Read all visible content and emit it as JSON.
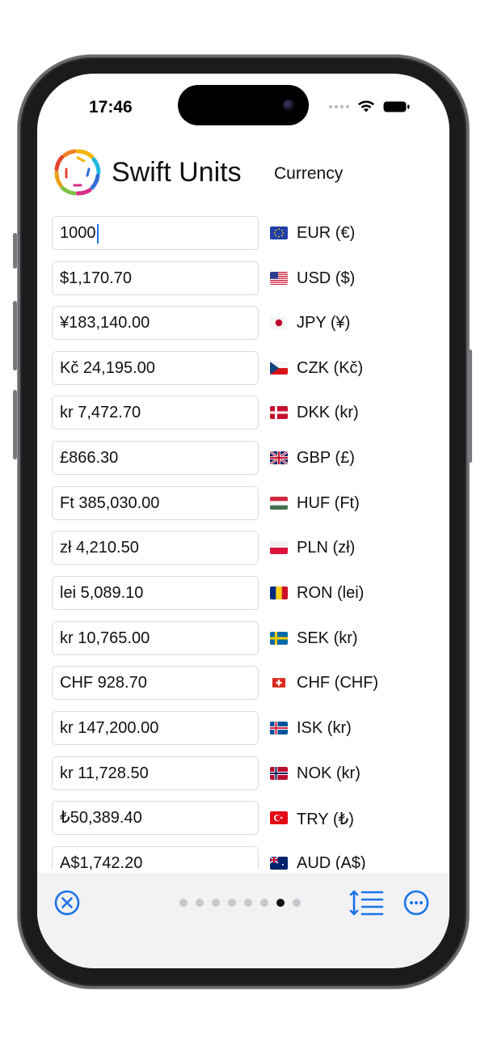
{
  "status": {
    "time": "17:46"
  },
  "header": {
    "app_title": "Swift Units",
    "section": "Currency"
  },
  "currencies": [
    {
      "value": "1000",
      "unit": "EUR (€)",
      "flag": "eu-flag",
      "active": true
    },
    {
      "value": "$1,170.70",
      "unit": "USD ($)",
      "flag": "us-flag"
    },
    {
      "value": "¥183,140.00",
      "unit": "JPY (¥)",
      "flag": "jp-flag"
    },
    {
      "value": "Kč 24,195.00",
      "unit": "CZK (Kč)",
      "flag": "cz-flag"
    },
    {
      "value": "kr 7,472.70",
      "unit": "DKK (kr)",
      "flag": "dk-flag"
    },
    {
      "value": "£866.30",
      "unit": "GBP (£)",
      "flag": "gb-flag"
    },
    {
      "value": "Ft 385,030.00",
      "unit": "HUF (Ft)",
      "flag": "hu-flag"
    },
    {
      "value": "zł 4,210.50",
      "unit": "PLN (zł)",
      "flag": "pl-flag"
    },
    {
      "value": "lei 5,089.10",
      "unit": "RON (lei)",
      "flag": "ro-flag"
    },
    {
      "value": "kr 10,765.00",
      "unit": "SEK (kr)",
      "flag": "se-flag"
    },
    {
      "value": "CHF 928.70",
      "unit": "CHF (CHF)",
      "flag": "ch-flag"
    },
    {
      "value": "kr 147,200.00",
      "unit": "ISK (kr)",
      "flag": "is-flag"
    },
    {
      "value": "kr 11,728.50",
      "unit": "NOK (kr)",
      "flag": "no-flag"
    },
    {
      "value": "₺50,389.40",
      "unit": "TRY (₺)",
      "flag": "tr-flag"
    },
    {
      "value": "A$1,742.20",
      "unit": "AUD (A$)",
      "flag": "au-flag"
    }
  ],
  "toolbar": {
    "close_icon": "close-circle-icon",
    "sort_icon": "sort-lines-icon",
    "more_icon": "more-circle-icon",
    "pages_total": 8,
    "page_current": 7
  },
  "colors": {
    "accent": "#1a73e8"
  }
}
